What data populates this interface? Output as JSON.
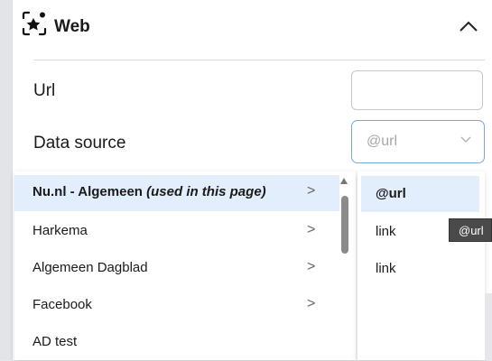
{
  "section": {
    "title": "Web",
    "icon": "sparkle-frame-icon"
  },
  "form": {
    "url_label": "Url",
    "url_value": "",
    "datasource_label": "Data source",
    "datasource_value": "@url"
  },
  "source_menu": {
    "items": [
      {
        "label": "Nu.nl - Algemeen",
        "note": "(used in this page)",
        "submenu": true,
        "active": true
      },
      {
        "label": "Harkema",
        "submenu": true
      },
      {
        "label": "Algemeen Dagblad",
        "submenu": true
      },
      {
        "label": "Facebook",
        "submenu": true
      },
      {
        "label": "AD test",
        "submenu": false
      }
    ],
    "arrow": ">"
  },
  "field_menu": {
    "options": [
      "@url",
      "link",
      "link"
    ],
    "active_index": 0
  },
  "tooltip": "@url",
  "colors": {
    "highlight": "#e2eefc",
    "focus_border": "#7aa7d7",
    "tooltip_bg": "#4a4a4a"
  }
}
